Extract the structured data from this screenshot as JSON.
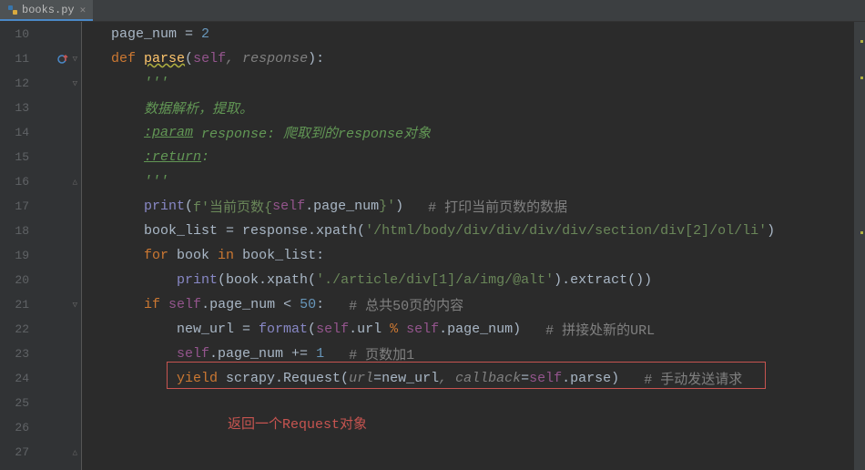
{
  "tab": {
    "filename": "books.py"
  },
  "lines": {
    "start": 10,
    "count": 18
  },
  "code": {
    "l10": {
      "var": "page_num",
      "eq": " = ",
      "val": "2"
    },
    "l11": {
      "kw": "def",
      "fn": "parse",
      "p1": "self",
      "p2": "response"
    },
    "l12": {
      "doc": "'''"
    },
    "l13": {
      "doc": "数据解析，提取。"
    },
    "l14": {
      "tag": ":param",
      "rest": " response: 爬取到的response对象"
    },
    "l15": {
      "tag": ":return",
      "rest": ":"
    },
    "l16": {
      "doc": "'''"
    },
    "l17": {
      "fn": "print",
      "fstr1": "f'当前页数{",
      "self": "self",
      "attr": ".page_num",
      "fstr2": "}'",
      "cm": "# 打印当前页数的数据"
    },
    "l18": {
      "var": "book_list = response.xpath(",
      "xpath": "'/html/body/div/div/div/div/section/div[2]/ol/li'",
      "end": ")"
    },
    "l19": {
      "kw1": "for",
      "var": " book ",
      "kw2": "in",
      "iter": " book_list:"
    },
    "l20": {
      "fn": "print",
      "pre": "(book.xpath(",
      "xpath": "'./article/div[1]/a/img/@alt'",
      "post": ").extract())"
    },
    "l21": {
      "kw": "if",
      "self": "self",
      "attr": ".page_num < ",
      "num": "50",
      "colon": ":",
      "cm": "# 总共50页的内容"
    },
    "l22": {
      "var": "new_url = ",
      "fn": "format",
      "open": "(",
      "self1": "self",
      "a1": ".url ",
      "op": "%",
      "self2": " self",
      "a2": ".page_num)",
      "cm": "# 拼接处新的URL"
    },
    "l23": {
      "self": "self",
      "attr": ".page_num += ",
      "num": "1",
      "cm": "# 页数加1"
    },
    "l24": {
      "kw": "yield",
      "call": " scrapy.Request(",
      "kw1": "url",
      "a1": "=new_url",
      "sep": ", ",
      "kw2": "callback",
      "eq": "=",
      "self": "self",
      "a2": ".parse)",
      "cm": "# 手动发送请求"
    },
    "l26": {
      "annotation": "返回一个Request对象"
    }
  },
  "colors": {
    "box": "#c75450",
    "bg": "#2b2b2b"
  }
}
